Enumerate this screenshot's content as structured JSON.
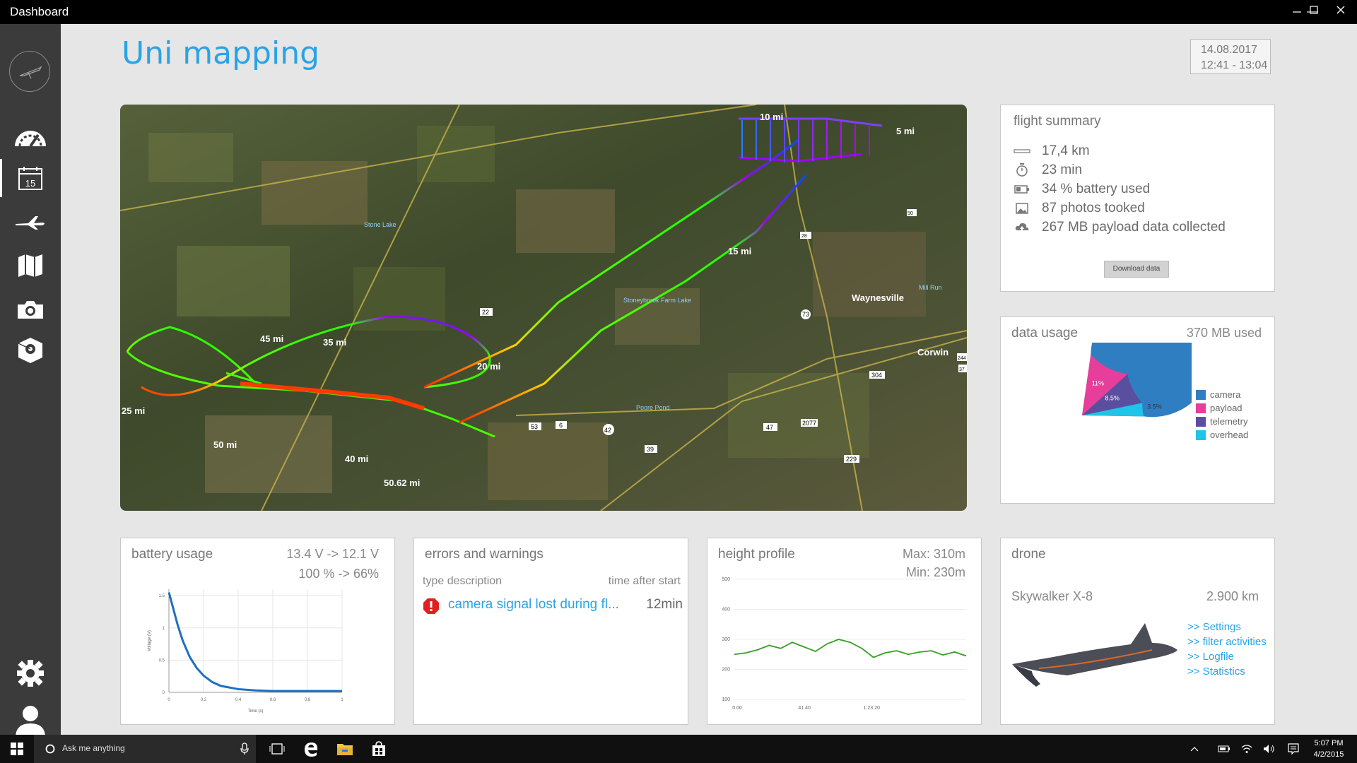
{
  "window": {
    "title": "Dashboard",
    "minimize": "—",
    "maximize": "☐",
    "close": "✕"
  },
  "sidebar": {
    "items": [
      {
        "icon": "dashboard-gauge-icon",
        "active": false
      },
      {
        "icon": "calendar-icon",
        "label": "15",
        "active": true
      },
      {
        "icon": "airplane-icon",
        "active": false
      },
      {
        "icon": "map-icon",
        "active": false
      },
      {
        "icon": "camera-icon",
        "active": false
      },
      {
        "icon": "package-icon",
        "active": false
      }
    ],
    "bottom": [
      {
        "icon": "settings-gear-icon"
      },
      {
        "icon": "user-icon"
      }
    ]
  },
  "header": {
    "title": "Uni mapping",
    "date": "14.08.2017",
    "time_range": "12:41 - 13:04"
  },
  "map": {
    "labels": {
      "lbl10mi": "10 mi",
      "lbl5mi": "5 mi",
      "lbl15mi": "15 mi",
      "lbl20mi": "20 mi",
      "lbl25mi": "25 mi",
      "lbl35mi": "35 mi",
      "lbl40mi": "40 mi",
      "lbl45mi": "45 mi",
      "lbl50mi": "50 mi",
      "lbl5062mi": "50.62 mi",
      "waynesville": "Waynesville",
      "corwin": "Corwin",
      "poore_pond": "Poore Pond",
      "stoneybrook": "Stoneybrook Farm Lake",
      "stone_lake": "Stone Lake",
      "mill_run": "Mill Run",
      "r22": "22",
      "r53": "53",
      "r6": "6",
      "r42": "42",
      "r39": "39",
      "r47": "47",
      "r2077": "2077",
      "r229": "229",
      "r304": "304",
      "r73": "73",
      "r244": "244",
      "r37": "37",
      "r28": "28",
      "r50": "50"
    }
  },
  "flight_summary": {
    "title": "flight summary",
    "rows": [
      {
        "icon": "ruler-icon",
        "text": "17,4 km"
      },
      {
        "icon": "stopwatch-icon",
        "text": "23 min"
      },
      {
        "icon": "battery-icon",
        "text": "34 % battery used"
      },
      {
        "icon": "photo-icon",
        "text": "87 photos tooked"
      },
      {
        "icon": "upload-cloud-icon",
        "text": "267 MB payload data collected"
      }
    ],
    "download_label": "Download data"
  },
  "data_usage": {
    "title": "data usage",
    "used": "370 MB used",
    "colors": {
      "camera": "#2f7ec1",
      "payload": "#e83e9b",
      "telemetry": "#5a4f9e",
      "overhead": "#1fc4e8"
    }
  },
  "battery": {
    "title": "battery usage",
    "voltage_range": "13.4 V -> 12.1 V",
    "percent_range": "100 % -> 66%",
    "xlabel": "Time (s)",
    "ylabel": "Voltage (V)"
  },
  "errors": {
    "title": "errors and warnings",
    "col_type": "type description",
    "col_time": "time after start",
    "items": [
      {
        "icon": "error-icon",
        "text": "camera signal lost during fl...",
        "time": "12min"
      }
    ]
  },
  "height": {
    "title": "height profile",
    "max": "Max: 310m",
    "min": "Min: 230m"
  },
  "drone": {
    "title": "drone",
    "model": "Skywalker X-8",
    "distance": "2.900 km",
    "links": [
      ">> Settings",
      ">> filter activities",
      ">> Logfile",
      ">> Statistics"
    ]
  },
  "taskbar": {
    "search_placeholder": "Ask me anything",
    "clock_time": "5:07 PM",
    "clock_date": "4/2/2015"
  },
  "chart_data": [
    {
      "type": "pie",
      "title": "",
      "categories": [
        "camera",
        "payload",
        "telemetry",
        "overhead"
      ],
      "values": [
        77,
        11,
        8.5,
        3.5
      ],
      "value_labels": [
        "77%",
        "11%",
        "8.5%",
        "3.5%"
      ],
      "legend": "right"
    },
    {
      "type": "line",
      "title": "",
      "xlabel": "Time (s)",
      "ylabel": "Voltage (V)",
      "x_ticks": [
        "0",
        "0.2",
        "0.4",
        "0.6",
        "0.8",
        "1"
      ],
      "y_ticks": [
        "0",
        "0.5",
        "1",
        "1.5"
      ],
      "xlim": [
        0,
        1
      ],
      "ylim": [
        0,
        1.6
      ],
      "series": [
        {
          "x": [
            0,
            0.02,
            0.05,
            0.08,
            0.12,
            0.16,
            0.2,
            0.25,
            0.3,
            0.4,
            0.5,
            0.6,
            0.7,
            0.8,
            0.9,
            1.0
          ],
          "y": [
            1.55,
            1.35,
            1.05,
            0.8,
            0.55,
            0.38,
            0.26,
            0.16,
            0.1,
            0.05,
            0.03,
            0.02,
            0.02,
            0.02,
            0.02,
            0.02
          ]
        }
      ]
    },
    {
      "type": "line",
      "title": "",
      "x_ticks": [
        "0.00",
        "41.40",
        "1:23.20"
      ],
      "y_ticks": [
        "100",
        "200",
        "300",
        "400",
        "500"
      ],
      "ylim": [
        100,
        500
      ],
      "series": [
        {
          "x": [
            0,
            5,
            10,
            15,
            20,
            25,
            30,
            35,
            40,
            45,
            50,
            55,
            60,
            65,
            70,
            75,
            80,
            85,
            90,
            95,
            100
          ],
          "y": [
            250,
            255,
            265,
            280,
            270,
            290,
            275,
            260,
            285,
            300,
            290,
            270,
            240,
            255,
            262,
            250,
            258,
            262,
            248,
            258,
            245
          ]
        }
      ]
    }
  ]
}
